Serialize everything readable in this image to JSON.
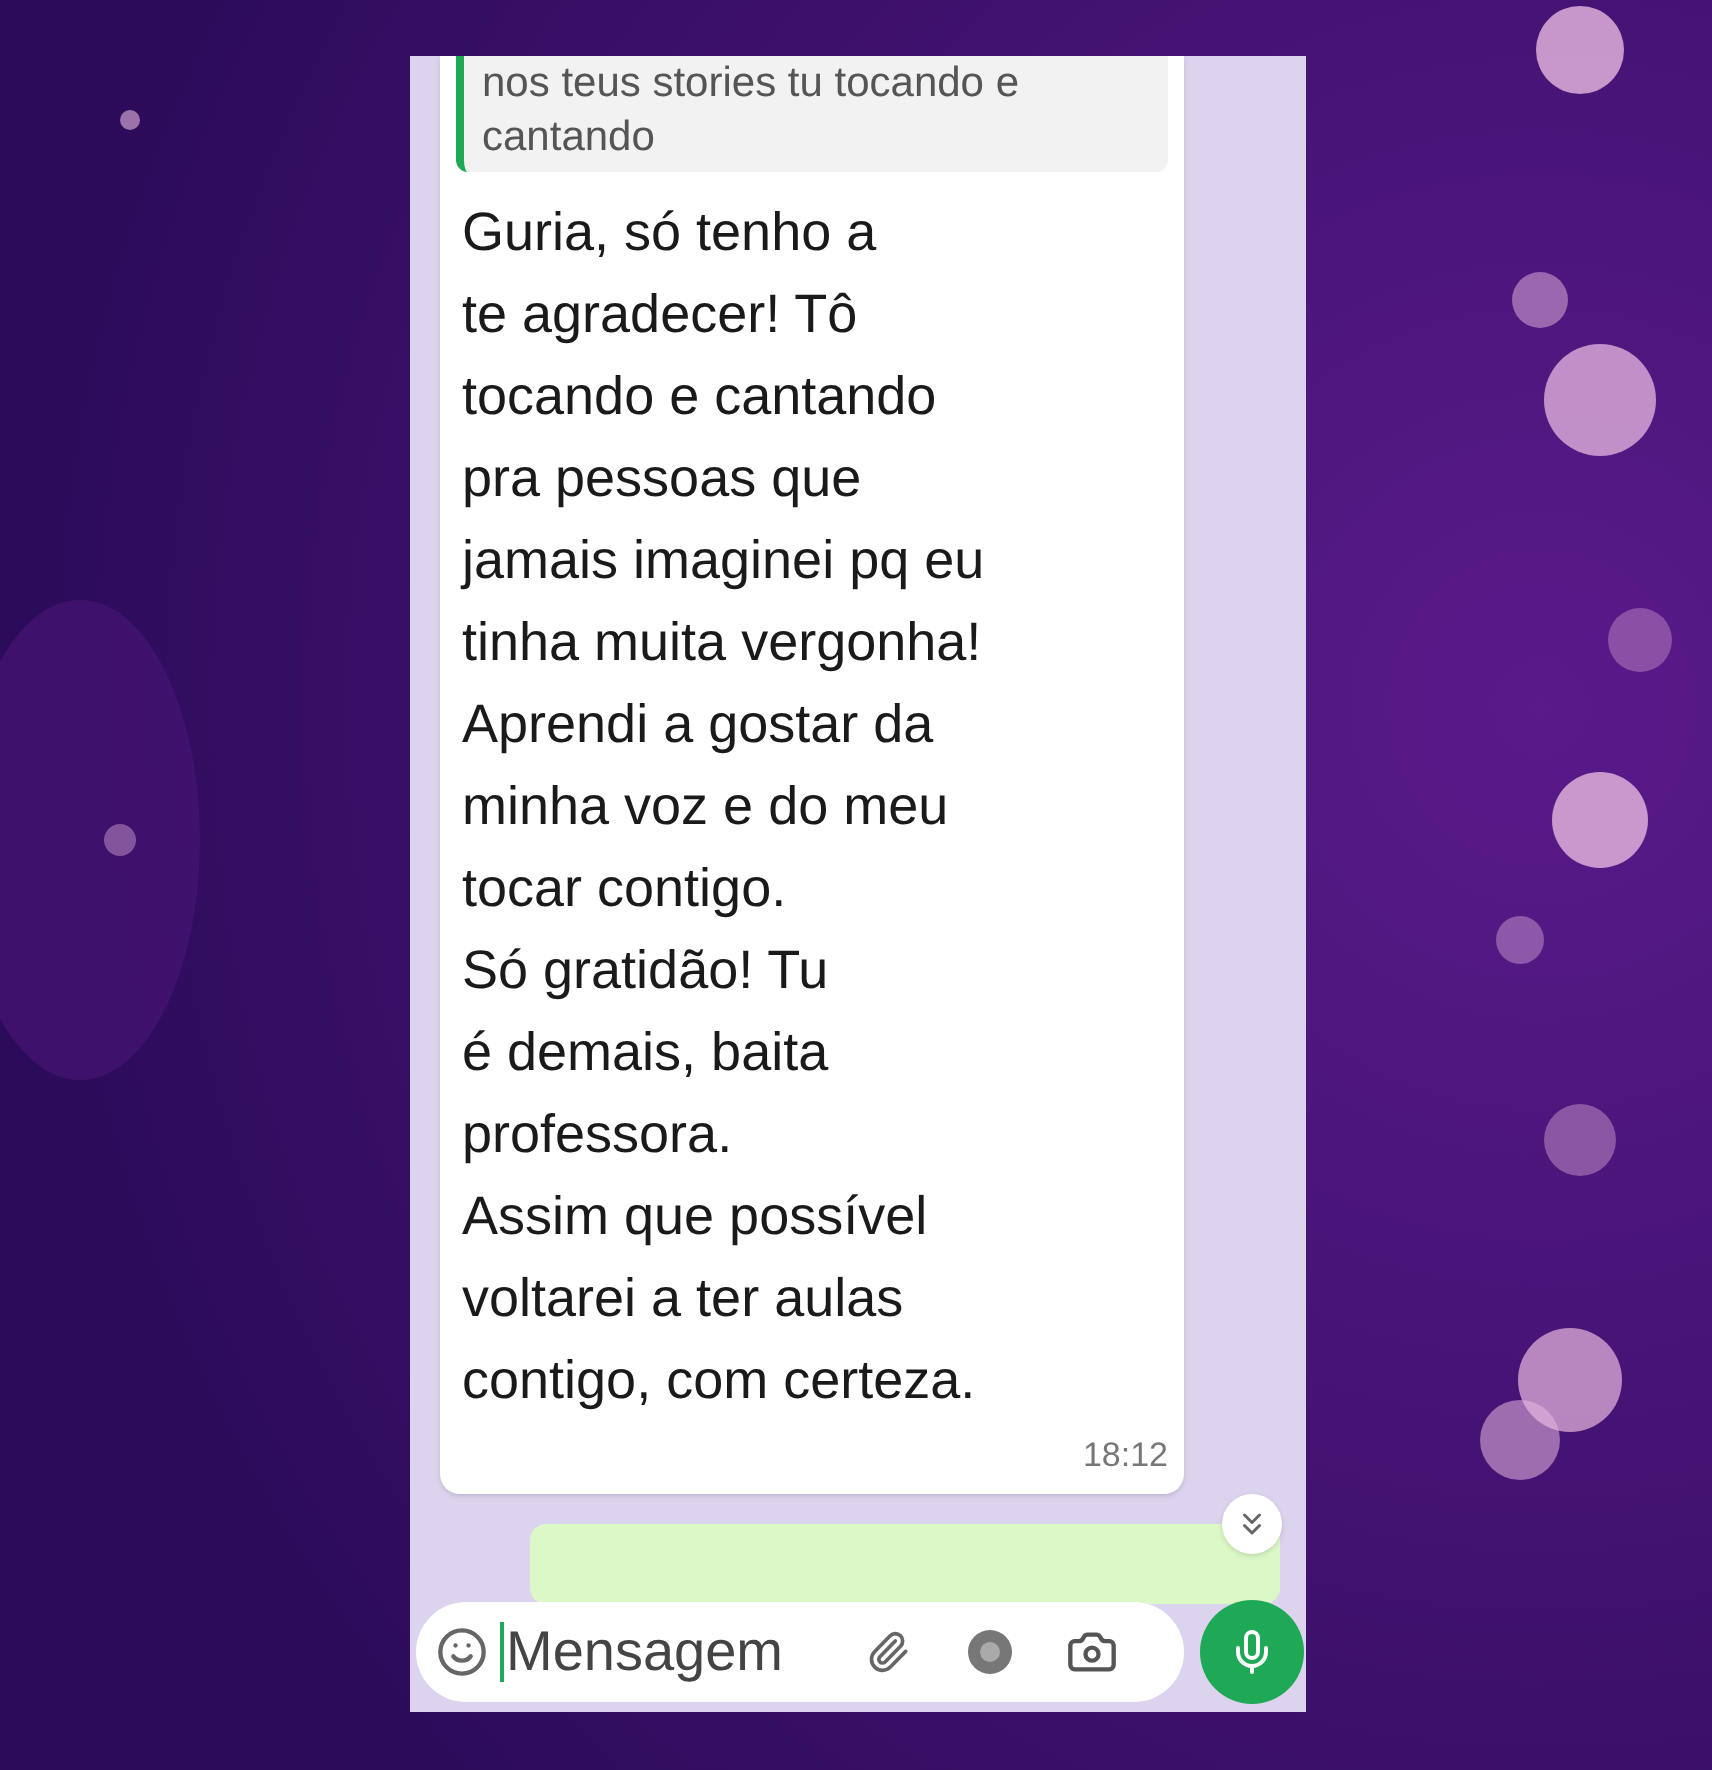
{
  "chat": {
    "quoted_message": {
      "text": "nos teus stories tu tocando e\ncantando"
    },
    "message": {
      "text": "Guria, só tenho a\nte agradecer! Tô\ntocando e cantando\npra pessoas que\njamais imaginei pq eu\ntinha muita vergonha!\nAprendi a gostar da\nminha voz e do meu\ntocar contigo.\nSó gratidão! Tu\né demais, baita\nprofessora.\nAssim que possível\nvoltarei a ter aulas\ncontigo, com certeza.",
      "time": "18:12"
    }
  },
  "composer": {
    "placeholder": "Mensagem"
  }
}
